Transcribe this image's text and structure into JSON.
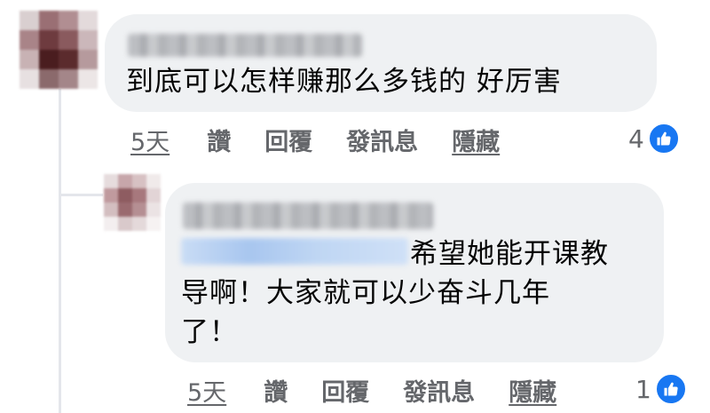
{
  "colors": {
    "bubble": "#eff1f3",
    "text": "#050505",
    "muted": "#65676b",
    "like": "#1877f2"
  },
  "comments": [
    {
      "author": "",
      "text": "到底可以怎样赚那么多钱的 好厉害",
      "time": "5天",
      "actions": [
        "讚",
        "回覆",
        "發訊息",
        "隱藏"
      ],
      "reaction_count": "4",
      "reaction_icon": "like-icon"
    },
    {
      "author": "",
      "mention": "",
      "text_lines": [
        "希望她能开课教",
        "导啊！大家就可以少奋斗几年",
        "了！"
      ],
      "time": "5天",
      "actions": [
        "讚",
        "回覆",
        "發訊息",
        "隱藏"
      ],
      "reaction_count": "1",
      "reaction_icon": "like-icon"
    }
  ]
}
